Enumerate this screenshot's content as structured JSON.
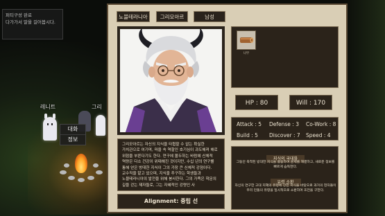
{
  "notice": {
    "line1": "퍼티구성 완료",
    "line2": "다가가서 말을 걸어봅시다."
  },
  "scene": {
    "npc_left_name": "레니트",
    "npc_right_name": "그리",
    "context_menu": [
      "대화",
      "정보"
    ]
  },
  "character": {
    "tabs": [
      "노블테라니아",
      "그리모아르",
      "남성"
    ],
    "inventory": [
      {
        "name": "나무",
        "icon": "wood-log-icon"
      }
    ],
    "hp_label": "HP : 80",
    "will_label": "Will : 170",
    "attributes": {
      "attack": "Attack : 5",
      "defense": "Defense : 3",
      "cowork": "Co-Work : 8",
      "build": "Build : 5",
      "discover": "Discover : 7",
      "speed": "Speed : 4"
    },
    "description": "그리모아르는 자신의 지식을 타협할 수 없는 확실한 가치관으로 여기며, 마을 속 역할인 호기심이 과도해져 해로 위험을 부른다기도 한다. 연구에 몰두하는 바람에 신체적 역량은 다소 건강이 위태해진 것이지만, 수십 년의 연구를 통해 얻은 방대한 지식이 그의 가장 큰 신체적 강점이다. 교수직을 맡고 있으며, 지식을 추구하는 학생들과 노블테라니아의 발전을 위해 봉사한다. 그의 가족은 학문의 길을 걷는 제자들로, 그는 자혜적인 강령인 사",
    "alignment": "Alignment: 중립 선",
    "traits": [
      {
        "title": "지식의 국대화",
        "desc": "그동안 축적된 방대한 지식을 활용하여 문제를 해결하고, 새로운 정보를 빠르게 습득한다."
      },
      {
        "title": "유령 소환",
        "desc": "자신의 연구한 고대 지혜의 유령에 강한 지식을 바탕으로 과거의 현자들이 우리 민들의 유령을 일시적으로 소환하여 조언을 구한다."
      }
    ]
  },
  "colors": {
    "panel_bg": "#d9ceb5",
    "box_bg": "#2b231a",
    "border": "#7a6a52",
    "text_light": "#ece3d0"
  }
}
